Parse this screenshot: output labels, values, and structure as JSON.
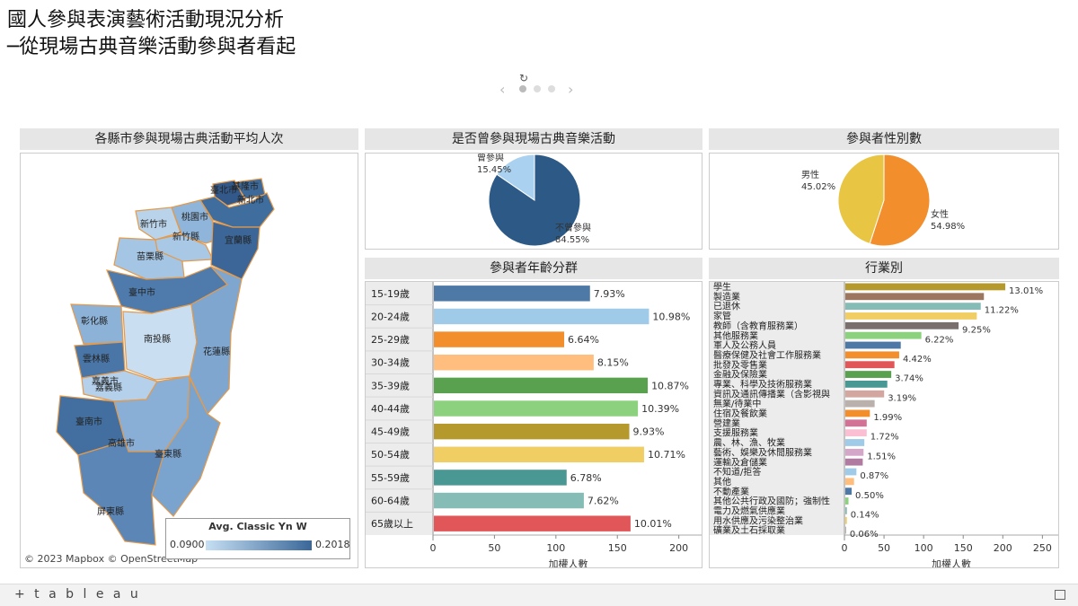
{
  "title_line1": "國人參與表演藝術活動現況分析",
  "title_line2": "─從現場古典音樂活動參與者看起",
  "map": {
    "title": "各縣市參與現場古典活動平均人次",
    "counties": [
      {
        "name": "基隆市",
        "color": "#3e6a9a"
      },
      {
        "name": "臺北市",
        "color": "#33598a"
      },
      {
        "name": "新北市",
        "color": "#3f6d9e"
      },
      {
        "name": "桃園市",
        "color": "#8fb5da"
      },
      {
        "name": "新竹市",
        "color": "#b9d3ea"
      },
      {
        "name": "新竹縣",
        "color": "#a9c8e6"
      },
      {
        "name": "宜蘭縣",
        "color": "#3b6697"
      },
      {
        "name": "苗栗縣",
        "color": "#a5c5e4"
      },
      {
        "name": "臺中市",
        "color": "#4e7aac"
      },
      {
        "name": "彰化縣",
        "color": "#8cb2d8"
      },
      {
        "name": "南投縣",
        "color": "#c9def0"
      },
      {
        "name": "花蓮縣",
        "color": "#7ea6cf"
      },
      {
        "name": "雲林縣",
        "color": "#4a76a7"
      },
      {
        "name": "嘉義市",
        "color": "#6f9acb"
      },
      {
        "name": "嘉義縣",
        "color": "#b4d0ea"
      },
      {
        "name": "臺南市",
        "color": "#426f9f"
      },
      {
        "name": "高雄市",
        "color": "#8aafd6"
      },
      {
        "name": "臺東縣",
        "color": "#7aa3ce"
      },
      {
        "name": "屏東縣",
        "color": "#5c86b6"
      }
    ],
    "legend": {
      "title": "Avg. Classic Yn W",
      "min": "0.0900",
      "max": "0.2018",
      "min_color": "#c6dff3",
      "max_color": "#3a6799"
    },
    "attribution": "© 2023 Mapbox  © OpenStreetMap"
  },
  "participation": {
    "title": "是否曾參與現場古典音樂活動",
    "slices": [
      {
        "label": "曾參與",
        "percent": "15.45%",
        "value": 15.45,
        "color": "#aad1ef"
      },
      {
        "label": "不曾參與",
        "percent": "84.55%",
        "value": 84.55,
        "color": "#2c5985"
      }
    ]
  },
  "gender": {
    "title": "參與者性別數",
    "slices": [
      {
        "label": "男性",
        "percent": "45.02%",
        "value": 45.02,
        "color": "#e9c544"
      },
      {
        "label": "女性",
        "percent": "54.98%",
        "value": 54.98,
        "color": "#f28e2b"
      }
    ]
  },
  "age": {
    "title": "參與者年齡分群",
    "xlabel": "加權人數",
    "ticks": [
      "0",
      "50",
      "100",
      "150",
      "200"
    ],
    "chart_data": {
      "type": "bar",
      "categories": [
        "15-19歲",
        "20-24歲",
        "25-29歲",
        "30-34歲",
        "35-39歲",
        "40-44歲",
        "45-49歲",
        "50-54歲",
        "55-59歲",
        "60-64歲",
        "65歲以上"
      ],
      "values": [
        127,
        175,
        106,
        130,
        174,
        166,
        159,
        171,
        108,
        122,
        160
      ],
      "labels": [
        "7.93%",
        "10.98%",
        "6.64%",
        "8.15%",
        "10.87%",
        "10.39%",
        "9.93%",
        "10.71%",
        "6.78%",
        "7.62%",
        "10.01%"
      ],
      "colors": [
        "#4e79a7",
        "#a0cbe8",
        "#f28e2b",
        "#ffbe7d",
        "#59a14f",
        "#8cd17d",
        "#b6992d",
        "#f1ce63",
        "#499894",
        "#86bcb6",
        "#e15759"
      ],
      "xlim": [
        0,
        220
      ]
    }
  },
  "industry": {
    "title": "行業別",
    "xlabel": "加權人數",
    "ticks": [
      "0",
      "50",
      "100",
      "150",
      "200",
      "250"
    ],
    "chart_data": {
      "type": "bar",
      "categories": [
        "學生",
        "製造業",
        "已退休",
        "家管",
        "教師（含教育服務業）",
        "其他服務業",
        "軍人及公務人員",
        "醫療保健及社會工作服務業",
        "批發及零售業",
        "金融及保險業",
        "專業、科學及技術服務業",
        "資訊及通訊傳播業（含影視與",
        "無業/待業中",
        "住宿及餐飲業",
        "營建業",
        "支援服務業",
        "農、林、漁、牧業",
        "藝術、娛樂及休閒服務業",
        "運輸及倉儲業",
        "不知道/拒答",
        "其他",
        "不動產業",
        "其他公共行政及國防；強制性",
        "電力及燃氣供應業",
        "用水供應及污染整治業",
        "礦業及土石採取業"
      ],
      "values": [
        202,
        175,
        171,
        166,
        143,
        96,
        70,
        68,
        62,
        58,
        53,
        49,
        37,
        31,
        27,
        27,
        24,
        23,
        22,
        14,
        11,
        8,
        4,
        2,
        2,
        1
      ],
      "labels": [
        "13.01%",
        "",
        "11.22%",
        "",
        "9.25%",
        "6.22%",
        "",
        "4.42%",
        "",
        "3.74%",
        "",
        "3.19%",
        "",
        "1.99%",
        "",
        "1.72%",
        "",
        "1.51%",
        "",
        "0.87%",
        "",
        "0.50%",
        "",
        "0.14%",
        "",
        "0.06%"
      ],
      "colors": [
        "#b6992d",
        "#9d7660",
        "#86bcb6",
        "#f1ce63",
        "#79706e",
        "#8cd17d",
        "#4e79a7",
        "#f28e2b",
        "#e15759",
        "#59a14f",
        "#499894",
        "#d4a6a0",
        "#bab0ac",
        "#f28e2b",
        "#d37295",
        "#fabfd2",
        "#a0cbe8",
        "#d4a6c8",
        "#b07aa1",
        "#a0cbe8",
        "#ffbe7d",
        "#4e79a7",
        "#8cd17d",
        "#86bcb6",
        "#f1ce63",
        "#bab0ac"
      ],
      "xlim": [
        0,
        270
      ]
    }
  },
  "footer": {
    "brand": "+ t a b l e a u"
  }
}
